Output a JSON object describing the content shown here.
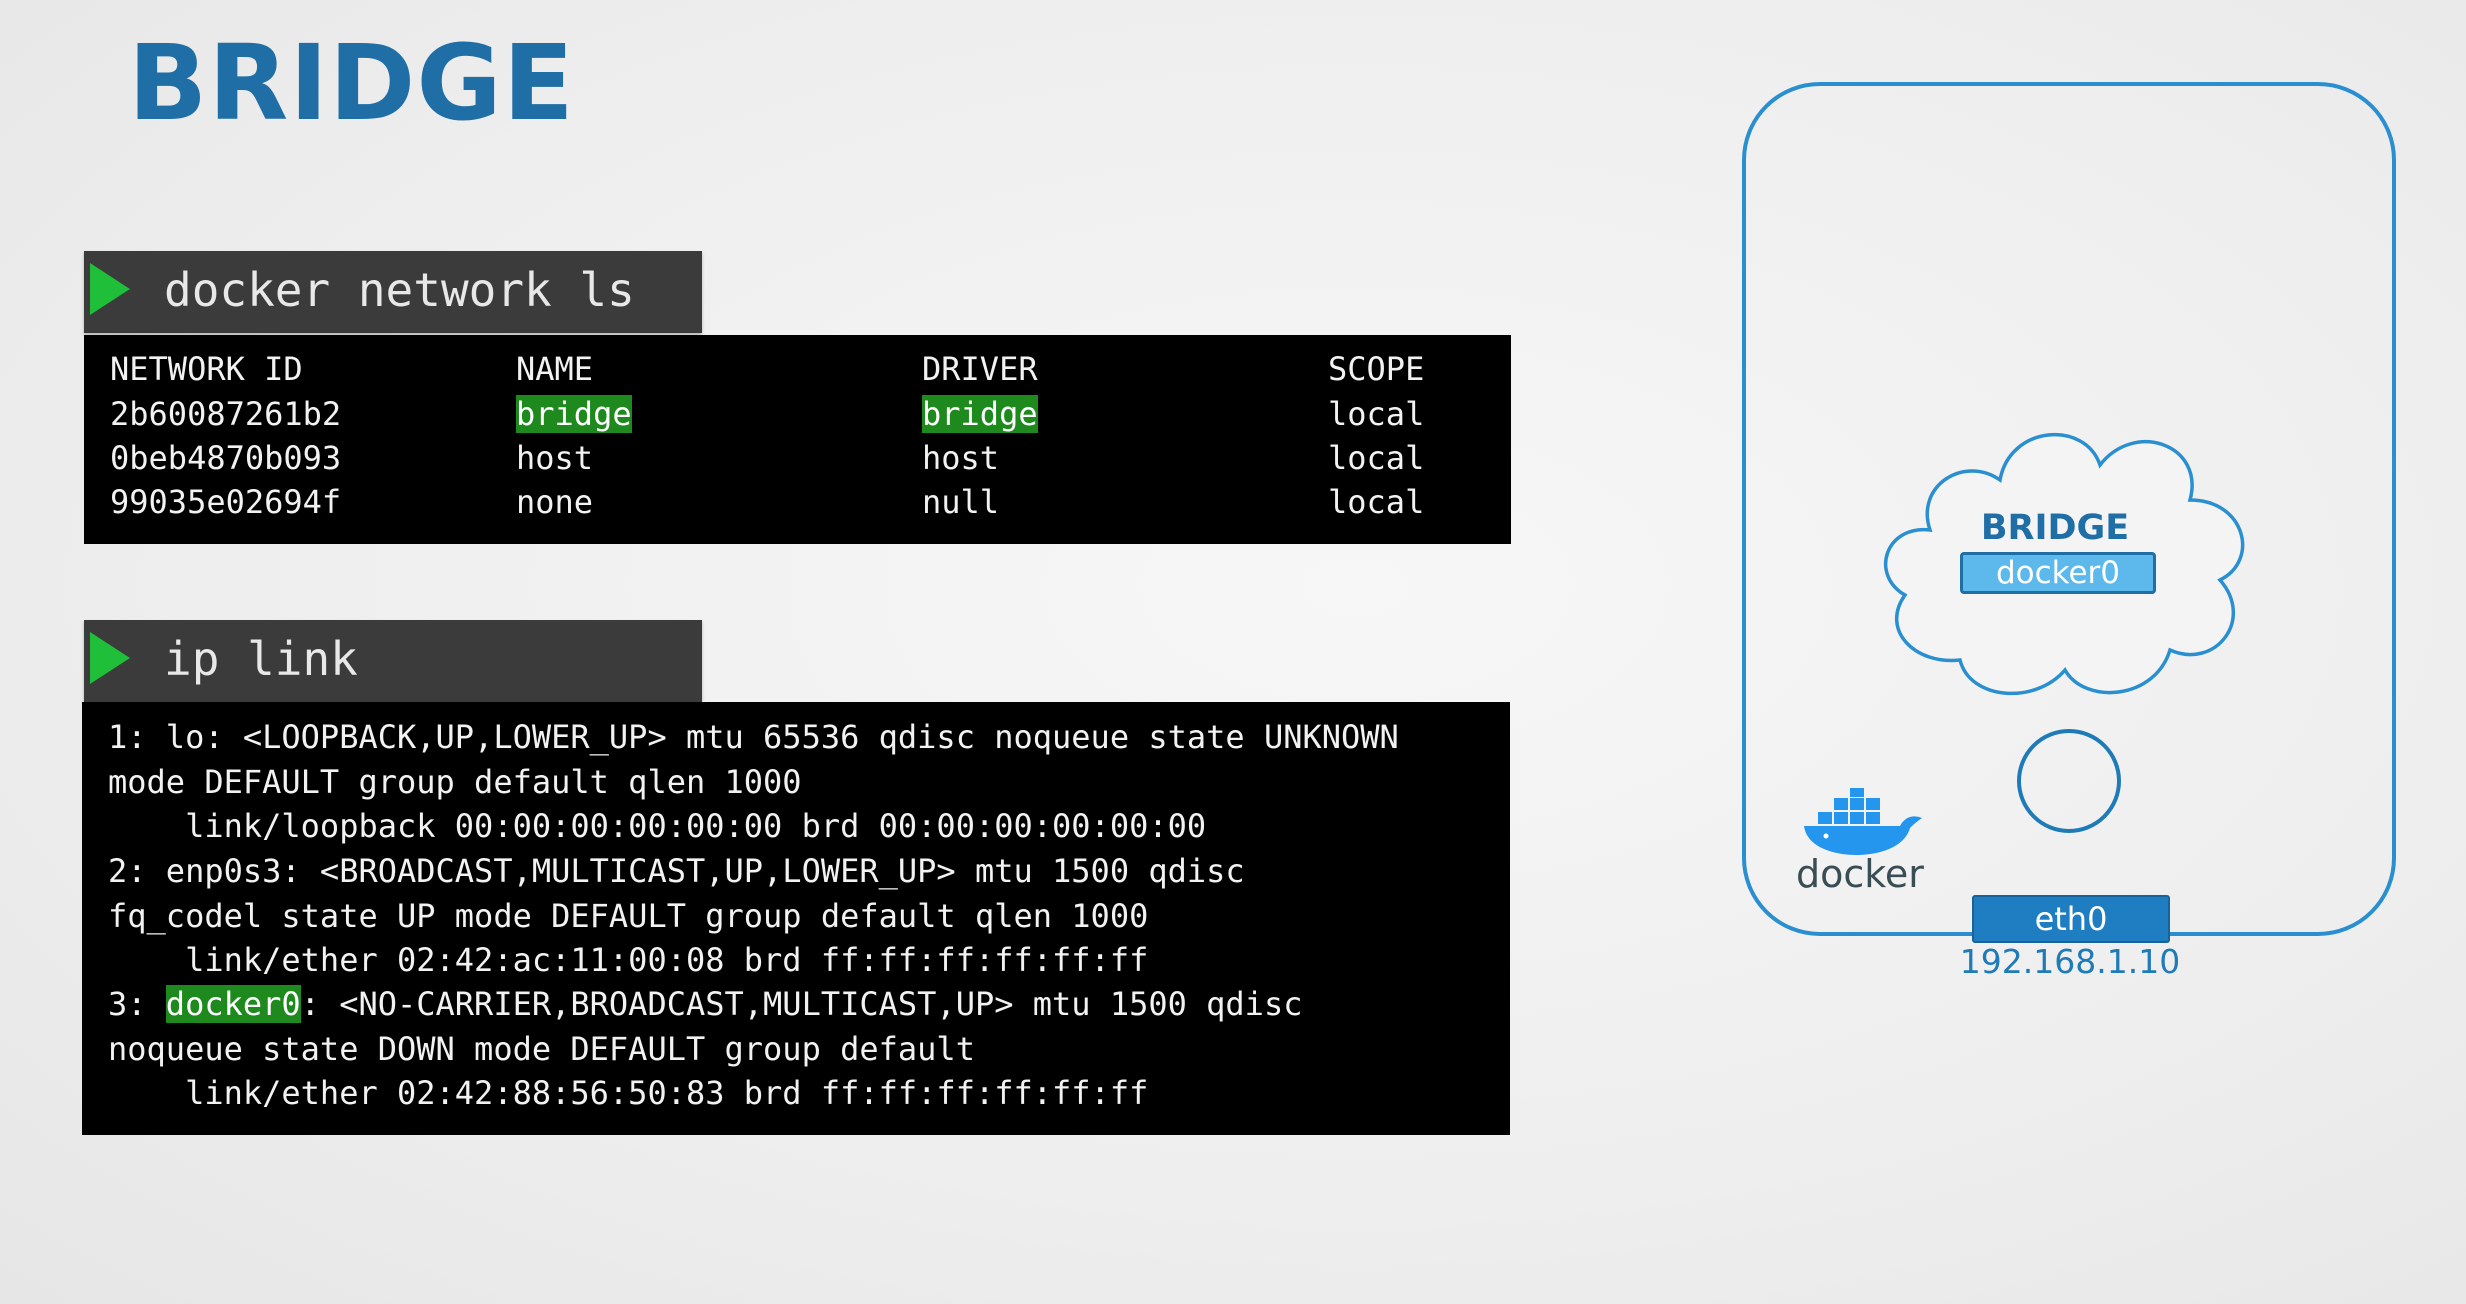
{
  "slide": {
    "title": "BRIDGE"
  },
  "network_ls": {
    "command": "docker network ls",
    "headers": [
      "NETWORK ID",
      "NAME",
      "DRIVER",
      "SCOPE"
    ],
    "rows": [
      [
        "2b60087261b2",
        "bridge",
        "bridge",
        "local"
      ],
      [
        "0beb4870b093",
        "host",
        "host",
        "local"
      ],
      [
        "99035e02694f",
        "none",
        "null",
        "local"
      ]
    ],
    "highlight_color": "#1e8a1e"
  },
  "ip_link": {
    "command": "ip link",
    "lines": [
      "1: lo: <LOOPBACK,UP,LOWER_UP> mtu 65536 qdisc noqueue state UNKNOWN",
      "mode DEFAULT group default qlen 1000",
      "    link/loopback 00:00:00:00:00:00 brd 00:00:00:00:00:00",
      "2: enp0s3: <BROADCAST,MULTICAST,UP,LOWER_UP> mtu 1500 qdisc",
      "fq_codel state UP mode DEFAULT group default qlen 1000",
      "    link/ether 02:42:ac:11:00:08 brd ff:ff:ff:ff:ff:ff",
      "3: ",
      "noqueue state DOWN mode DEFAULT group default",
      "    link/ether 02:42:88:56:50:83 brd ff:ff:ff:ff:ff:ff"
    ],
    "docker0_highlight": "docker0",
    "docker0_rest": ": <NO-CARRIER,BROADCAST,MULTICAST,UP> mtu 1500 qdisc"
  },
  "diagram": {
    "bridge_label": "BRIDGE",
    "bridge_interface": "docker0",
    "host_interface": "eth0",
    "host_ip": "192.168.1.10",
    "logo_text": "docker",
    "colors": {
      "accent": "#1f6ea6",
      "border": "#2a8fd0",
      "docker_blue": "#2496ed"
    }
  }
}
